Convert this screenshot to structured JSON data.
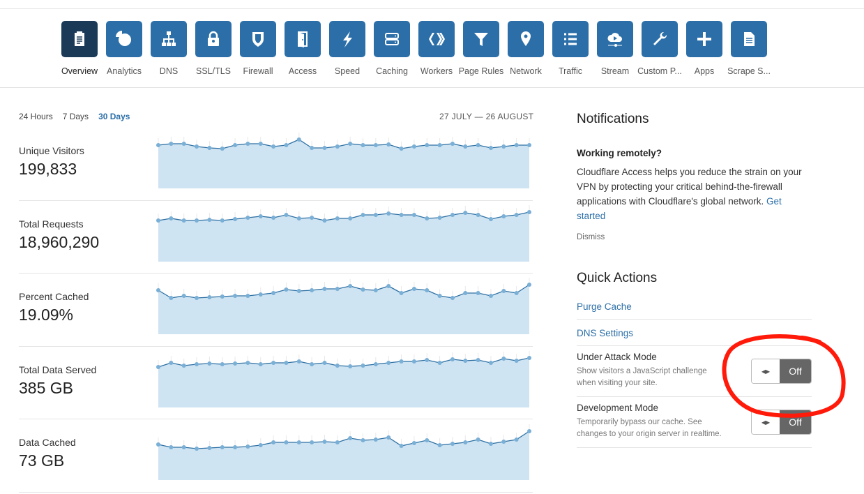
{
  "nav": [
    {
      "label": "Overview",
      "icon": "clipboard-icon",
      "active": true
    },
    {
      "label": "Analytics",
      "icon": "pie-chart-icon"
    },
    {
      "label": "DNS",
      "icon": "sitemap-icon"
    },
    {
      "label": "SSL/TLS",
      "icon": "lock-icon"
    },
    {
      "label": "Firewall",
      "icon": "shield-icon"
    },
    {
      "label": "Access",
      "icon": "door-icon"
    },
    {
      "label": "Speed",
      "icon": "lightning-icon"
    },
    {
      "label": "Caching",
      "icon": "server-icon"
    },
    {
      "label": "Workers",
      "icon": "workers-icon"
    },
    {
      "label": "Page Rules",
      "icon": "filter-icon"
    },
    {
      "label": "Network",
      "icon": "map-pin-icon"
    },
    {
      "label": "Traffic",
      "icon": "list-icon"
    },
    {
      "label": "Stream",
      "icon": "cloud-play-icon"
    },
    {
      "label": "Custom P...",
      "icon": "wrench-icon"
    },
    {
      "label": "Apps",
      "icon": "plus-icon"
    },
    {
      "label": "Scrape S...",
      "icon": "document-icon"
    }
  ],
  "ranges": [
    "24 Hours",
    "7 Days",
    "30 Days"
  ],
  "selected_range": "30 Days",
  "date_range": "27 JULY — 26 AUGUST",
  "metrics": [
    {
      "label": "Unique Visitors",
      "value": "199,833",
      "trend": [
        62,
        64,
        64,
        60,
        58,
        57,
        62,
        64,
        64,
        60,
        62,
        70,
        58,
        58,
        60,
        64,
        62,
        62,
        63,
        57,
        60,
        62,
        62,
        64,
        60,
        62,
        58,
        60,
        62,
        62
      ]
    },
    {
      "label": "Total Requests",
      "value": "18,960,290",
      "trend": [
        59,
        62,
        59,
        59,
        60,
        59,
        61,
        63,
        65,
        63,
        67,
        62,
        63,
        59,
        62,
        62,
        67,
        67,
        69,
        67,
        67,
        62,
        63,
        67,
        70,
        67,
        61,
        65,
        67,
        71
      ]
    },
    {
      "label": "Percent Cached",
      "value": "19.09%",
      "trend": [
        63,
        52,
        55,
        52,
        53,
        54,
        55,
        55,
        57,
        59,
        64,
        62,
        63,
        65,
        65,
        69,
        64,
        63,
        69,
        59,
        65,
        63,
        55,
        52,
        59,
        59,
        55,
        62,
        59,
        71
      ]
    },
    {
      "label": "Total Data Served",
      "value": "385 GB",
      "trend": [
        58,
        64,
        60,
        62,
        63,
        62,
        63,
        64,
        62,
        64,
        64,
        66,
        62,
        64,
        60,
        59,
        60,
        62,
        64,
        66,
        66,
        68,
        64,
        69,
        67,
        68,
        64,
        70,
        67,
        71
      ]
    },
    {
      "label": "Data Cached",
      "value": "73 GB",
      "trend": [
        51,
        47,
        47,
        45,
        46,
        47,
        47,
        48,
        50,
        54,
        54,
        54,
        54,
        55,
        54,
        60,
        57,
        58,
        61,
        49,
        53,
        57,
        50,
        52,
        54,
        58,
        52,
        55,
        58,
        70
      ]
    }
  ],
  "colors": {
    "accent": "#2c6fa8",
    "tile_active": "#1b3a57",
    "area": "#cfe4f2",
    "line": "#2d6fa3",
    "dot": "#7aafd6",
    "annotation": "#ff1a0a"
  },
  "notifications": {
    "title": "Notifications",
    "heading": "Working remotely?",
    "body": "Cloudflare Access helps you reduce the strain on your VPN by protecting your critical behind-the-firewall applications with Cloudflare's global network.",
    "link": "Get started",
    "dismiss": "Dismiss"
  },
  "quick_actions": {
    "title": "Quick Actions",
    "purge": "Purge Cache",
    "dns": "DNS Settings",
    "toggles": [
      {
        "title": "Under Attack Mode",
        "desc": "Show visitors a JavaScript challenge when visiting your site.",
        "state": "Off"
      },
      {
        "title": "Development Mode",
        "desc": "Temporarily bypass our cache. See changes to your origin server in realtime.",
        "state": "Off"
      }
    ]
  }
}
